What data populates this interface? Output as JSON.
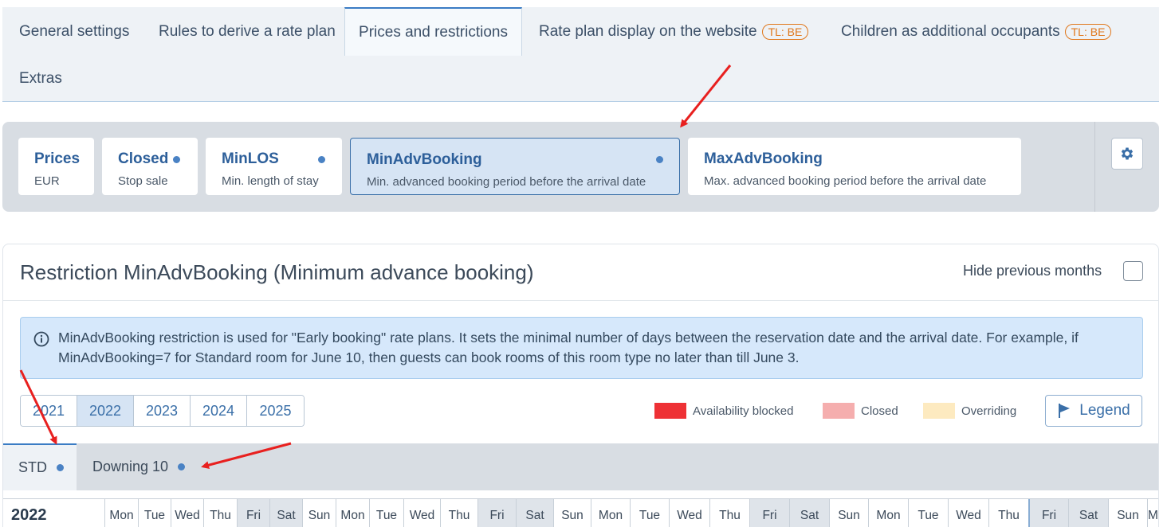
{
  "top_tabs": [
    {
      "label": "General settings"
    },
    {
      "label": "Rules to derive a rate plan"
    },
    {
      "label": "Prices and restrictions"
    },
    {
      "label": "Rate plan display on the website",
      "badge": "TL: BE"
    },
    {
      "label": "Children as additional occupants",
      "badge": "TL: BE"
    },
    {
      "label": "Extras"
    }
  ],
  "cards": [
    {
      "title": "Prices",
      "subtitle": "EUR"
    },
    {
      "title": "Closed",
      "subtitle": "Stop sale"
    },
    {
      "title": "MinLOS",
      "subtitle": "Min. length of stay"
    },
    {
      "title": "MinAdvBooking",
      "subtitle": "Min. advanced booking period before the arrival date"
    },
    {
      "title": "MaxAdvBooking",
      "subtitle": "Max. advanced booking period before the arrival date"
    }
  ],
  "section": {
    "title": "Restriction MinAdvBooking (Minimum advance booking)",
    "hide_label": "Hide previous months",
    "info_text": "MinAdvBooking restriction is used for \"Early booking\" rate plans. It sets the minimal number of days between the reservation date and the arrival date. For example, if MinAdvBooking=7 for Standard room for June 10, then guests can book rooms of this room type no later than till June 3."
  },
  "years": [
    "2021",
    "2022",
    "2023",
    "2024",
    "2025"
  ],
  "selected_year": "2022",
  "legend": [
    {
      "label": "Availability blocked",
      "color": "#ee3135"
    },
    {
      "label": "Closed",
      "color": "#f5aeae"
    },
    {
      "label": "Overriding",
      "color": "#fdeac0"
    }
  ],
  "legend_button": "Legend",
  "room_tabs": [
    {
      "label": "STD"
    },
    {
      "label": "Downing 10"
    }
  ],
  "calendar": {
    "year": "2022",
    "days": [
      "Mon",
      "Tue",
      "Wed",
      "Thu",
      "Fri",
      "Sat",
      "Sun",
      "Mon",
      "Tue",
      "Wed",
      "Thu",
      "Fri",
      "Sat",
      "Sun",
      "Mon",
      "Tue",
      "Wed",
      "Thu",
      "Fri",
      "Sat",
      "Sun",
      "Mon",
      "Tue",
      "Wed",
      "Thu",
      "Fri",
      "Sat",
      "Sun",
      "M"
    ]
  },
  "colors": {
    "accent": "#3a6fa8",
    "badge": "#e0771b",
    "annotation_arrow": "#e8201f"
  }
}
